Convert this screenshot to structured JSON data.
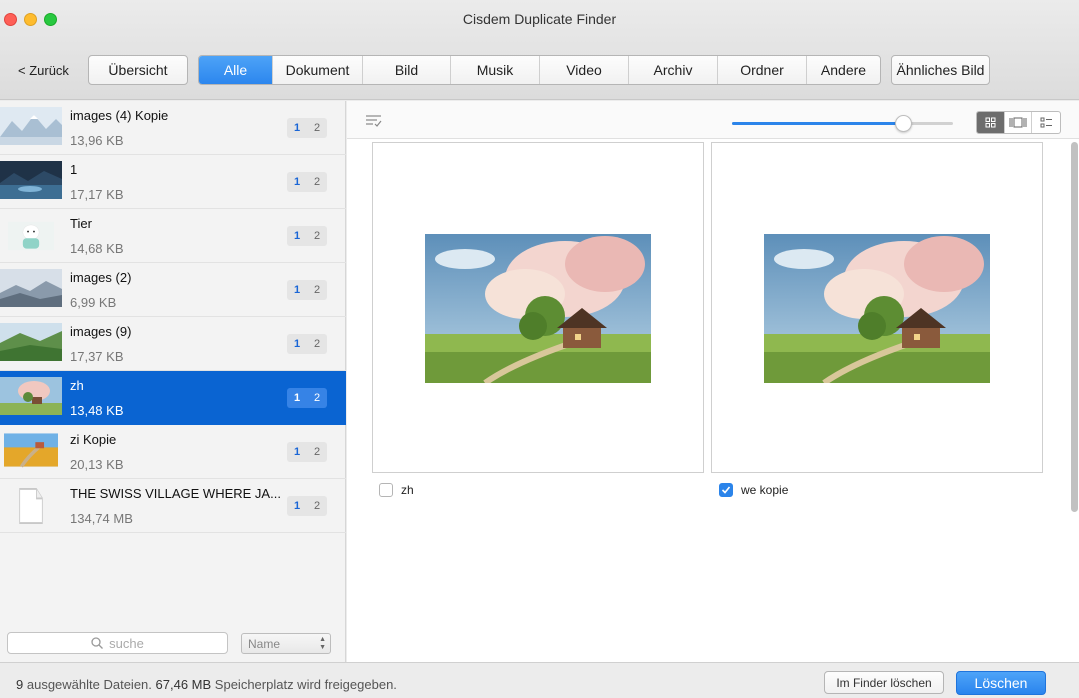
{
  "window": {
    "title": "Cisdem Duplicate Finder"
  },
  "toolbar": {
    "back_label": "< Zurück",
    "overview_label": "Übersicht",
    "similar_image_label": "Ähnliches Bild",
    "categories": [
      {
        "label": "Alle",
        "active": true
      },
      {
        "label": "Dokument",
        "active": false
      },
      {
        "label": "Bild",
        "active": false
      },
      {
        "label": "Musik",
        "active": false
      },
      {
        "label": "Video",
        "active": false
      },
      {
        "label": "Archiv",
        "active": false
      },
      {
        "label": "Ordner",
        "active": false
      },
      {
        "label": "Andere",
        "active": false
      }
    ]
  },
  "sidebar": {
    "items": [
      {
        "name": "images (4) Kopie",
        "size": "13,96 KB",
        "badge_a": "1",
        "badge_b": "2",
        "thumb": "snowy-mountains"
      },
      {
        "name": "1",
        "size": "17,17 KB",
        "badge_a": "1",
        "badge_b": "2",
        "thumb": "night-lake"
      },
      {
        "name": "Tier",
        "size": "14,68 KB",
        "badge_a": "1",
        "badge_b": "2",
        "thumb": "white-puppy"
      },
      {
        "name": "images (2)",
        "size": "6,99 KB",
        "badge_a": "1",
        "badge_b": "2",
        "thumb": "misty-hills"
      },
      {
        "name": "images (9)",
        "size": "17,37 KB",
        "badge_a": "1",
        "badge_b": "2",
        "thumb": "green-terraces"
      },
      {
        "name": "zh",
        "size": "13,48 KB",
        "badge_a": "1",
        "badge_b": "2",
        "thumb": "cottage-sky",
        "selected": true
      },
      {
        "name": "zi Kopie",
        "size": "20,13 KB",
        "badge_a": "1",
        "badge_b": "2",
        "thumb": "flower-field"
      },
      {
        "name": "THE SWISS VILLAGE WHERE JA...",
        "size": "134,74 MB",
        "badge_a": "1",
        "badge_b": "2",
        "thumb": "document-icon"
      }
    ],
    "search_placeholder": "suche",
    "sort_value": "Name"
  },
  "main": {
    "zoom_level": 0.78,
    "view_modes": [
      "grid-view-icon",
      "filmstrip-view-icon",
      "list-view-icon"
    ],
    "active_view": "grid-view-icon",
    "cards": [
      {
        "filename": "zh",
        "checked": false
      },
      {
        "filename": "we kopie",
        "checked": true
      }
    ]
  },
  "status": {
    "count": "9",
    "count_suffix": "ausgewählte Dateien.",
    "size": "67,46 MB",
    "size_suffix": "Speicherplatz wird freigegeben.",
    "finder_delete_label": "Im Finder löschen",
    "delete_label": "Löschen"
  },
  "colors": {
    "accent": "#2b84ea",
    "selection": "#0a64d2"
  }
}
